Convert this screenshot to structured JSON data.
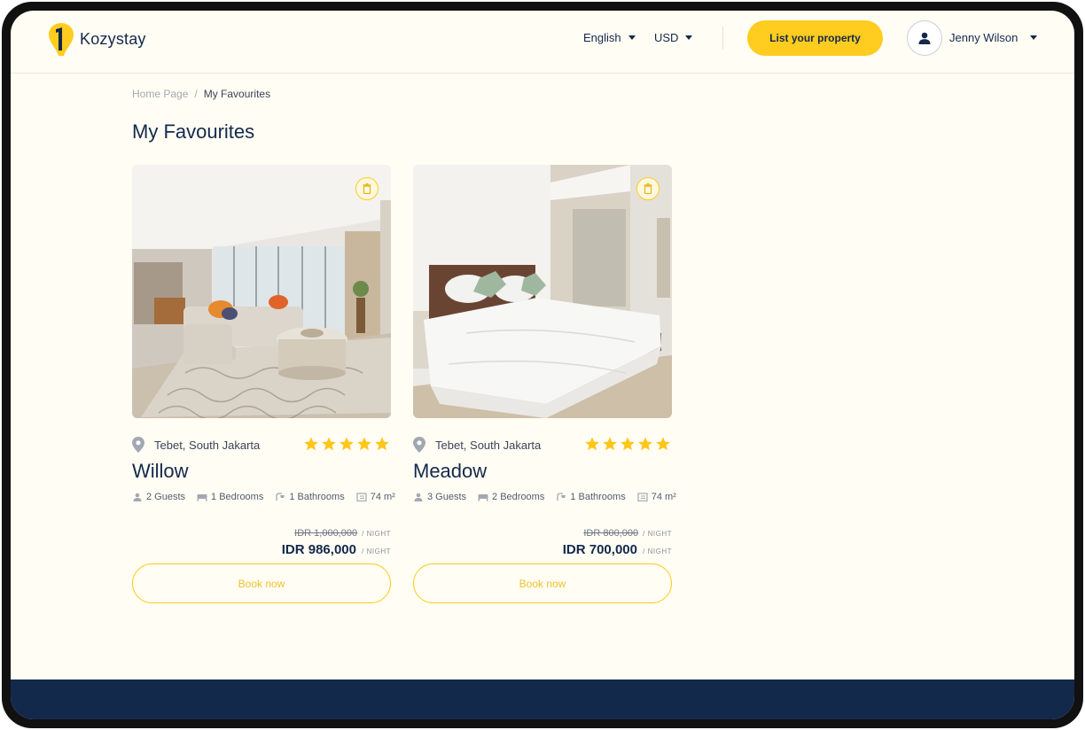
{
  "brand": {
    "name": "Kozystay"
  },
  "header": {
    "language": "English",
    "currency": "USD",
    "list_property_label": "List your property",
    "user_name": "Jenny Wilson"
  },
  "breadcrumb": {
    "home": "Home Page",
    "separator": "/",
    "current": "My Favourites"
  },
  "page": {
    "title": "My Favourites"
  },
  "colors": {
    "accent": "#ffcc1f",
    "navy": "#13294b",
    "background": "#fffdf4"
  },
  "favourites": [
    {
      "location": "Tebet, South Jakarta",
      "rating": 5,
      "name": "Willow",
      "guests": "2 Guests",
      "bedrooms": "1 Bedrooms",
      "bathrooms": "1 Bathrooms",
      "area": "74 m²",
      "price_original": "IDR 1,000,000",
      "price_current": "IDR 986,000",
      "per_night": "/ NIGHT",
      "book_label": "Book now",
      "photo": "living-room-photo"
    },
    {
      "location": "Tebet, South Jakarta",
      "rating": 5,
      "name": "Meadow",
      "guests": "3 Guests",
      "bedrooms": "2 Bedrooms",
      "bathrooms": "1 Bathrooms",
      "area": "74 m²",
      "price_original": "IDR 800,000",
      "price_current": "IDR 700,000",
      "per_night": "/ NIGHT",
      "book_label": "Book now",
      "photo": "bedroom-photo"
    }
  ]
}
